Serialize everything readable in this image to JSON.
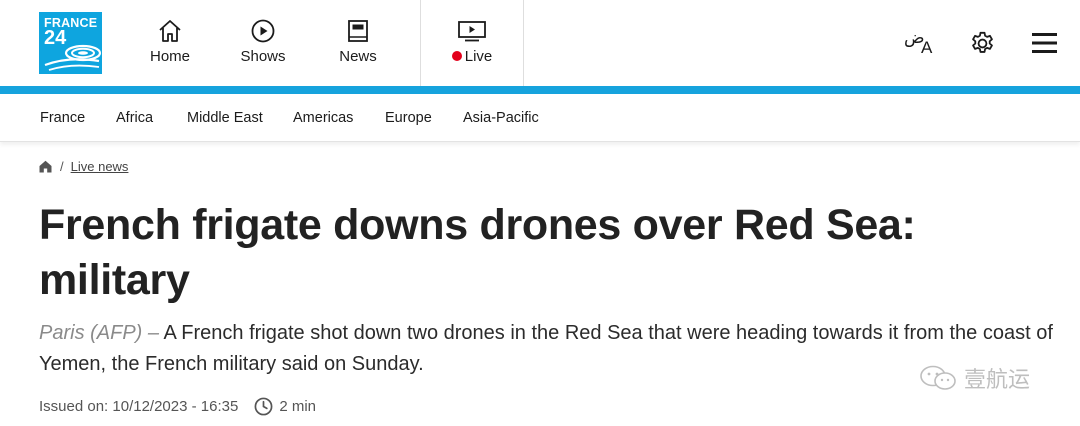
{
  "header": {
    "logo_line1": "FRANCE",
    "logo_line2": "24",
    "brand_color": "#0ea5df",
    "nav": [
      {
        "label": "Home",
        "icon": "home-icon"
      },
      {
        "label": "Shows",
        "icon": "play-circle-icon"
      },
      {
        "label": "News",
        "icon": "newspaper-icon"
      },
      {
        "label": "Live",
        "icon": "tv-play-icon",
        "indicator_color": "#e3001b"
      }
    ],
    "language_icon_text": "ض",
    "language_icon_latin": "A",
    "actions": [
      "language-icon",
      "gear-icon",
      "menu-icon"
    ]
  },
  "sections": [
    "France",
    "Africa",
    "Middle East",
    "Americas",
    "Europe",
    "Asia-Pacific"
  ],
  "breadcrumb": {
    "home_icon": "home-icon",
    "separator": "/",
    "current": "Live news"
  },
  "article": {
    "headline": "French frigate downs drones over Red Sea: military",
    "dateline": "Paris (AFP) –",
    "lead": "A French frigate shot down two drones in the Red Sea that were heading towards it from the coast of Yemen, the French military said on Sunday.",
    "issued": "Issued on: 10/12/2023 - 16:35",
    "read_time": "2 min",
    "read_time_icon": "clock-icon"
  },
  "watermark": {
    "text": "壹航运",
    "icon": "wechat-icon"
  },
  "colors": {
    "accent_band": "#16a3dd",
    "live_dot": "#e3001b",
    "text": "#222222"
  }
}
